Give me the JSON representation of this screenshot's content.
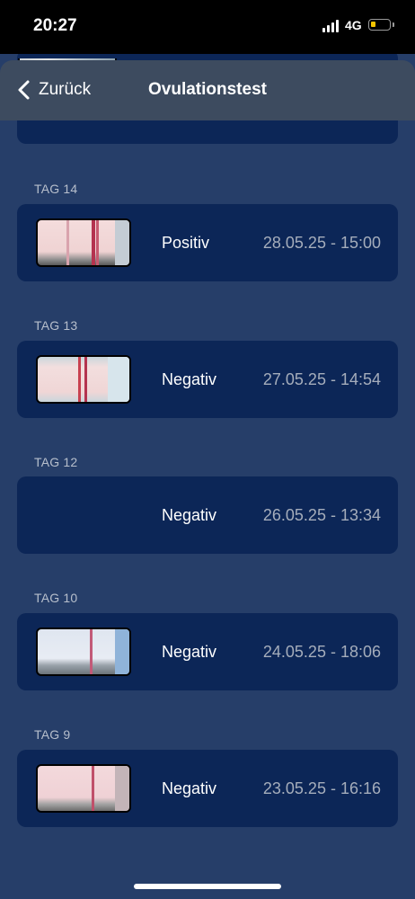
{
  "status_bar": {
    "time": "20:27",
    "network": "4G"
  },
  "nav": {
    "back_label": "Zurück",
    "title": "Ovulationstest"
  },
  "entries": [
    {
      "day_label": "TAG 14",
      "result": "Positiv",
      "datetime": "28.05.25 - 15:00",
      "has_photo": true
    },
    {
      "day_label": "TAG 13",
      "result": "Negativ",
      "datetime": "27.05.25 - 14:54",
      "has_photo": true
    },
    {
      "day_label": "TAG 12",
      "result": "Negativ",
      "datetime": "26.05.25 - 13:34",
      "has_photo": false
    },
    {
      "day_label": "TAG 10",
      "result": "Negativ",
      "datetime": "24.05.25 - 18:06",
      "has_photo": true
    },
    {
      "day_label": "TAG 9",
      "result": "Negativ",
      "datetime": "23.05.25 - 16:16",
      "has_photo": true
    }
  ],
  "colors": {
    "background": "#263e69",
    "card": "#0c2657",
    "navbar": "#3d4b5f",
    "secondary_text": "#a5adbb",
    "test_line": "#b4334f"
  }
}
